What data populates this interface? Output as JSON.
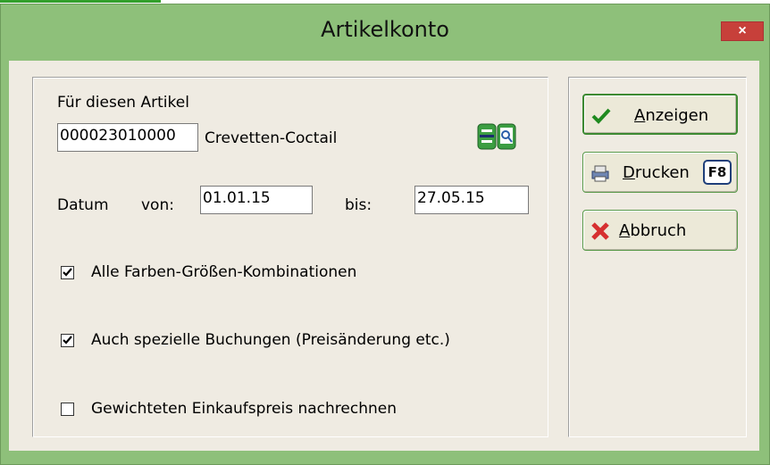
{
  "dialog": {
    "title": "Artikelkonto",
    "close_label": "×"
  },
  "form": {
    "article_label": "Für diesen Artikel",
    "article_number": "000023010000",
    "article_name": "Crevetten-Coctail",
    "date_label": "Datum",
    "from_label": "von:",
    "from_value": "01.01.15",
    "to_label": "bis:",
    "to_value": "27.05.15"
  },
  "options": [
    {
      "label": "Alle Farben-Größen-Kombinationen",
      "checked": true
    },
    {
      "label": "Auch spezielle Buchungen (Preisänderung etc.)",
      "checked": true
    },
    {
      "label": "Gewichteten Einkaufspreis nachrechnen",
      "checked": false
    }
  ],
  "buttons": {
    "show": {
      "mnemonic": "A",
      "rest": "nzeigen",
      "icon": "checkmark-icon"
    },
    "print": {
      "mnemonic": "D",
      "rest": "rucken",
      "fkey": "F8",
      "icon": "printer-icon"
    },
    "cancel": {
      "mnemonic": "A",
      "rest": "bbruch",
      "icon": "red-x-icon"
    }
  },
  "colors": {
    "window_frame": "#8ec07a",
    "client": "#efebe2",
    "close_button": "#c7403a",
    "accent_green": "#3d8a32"
  }
}
